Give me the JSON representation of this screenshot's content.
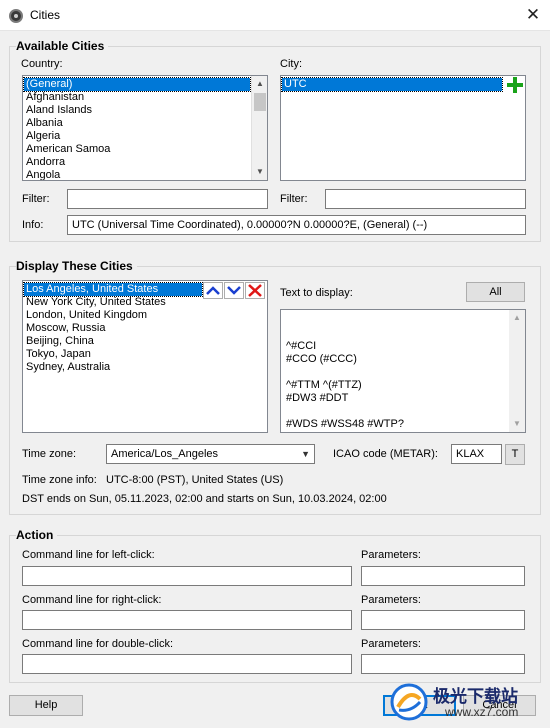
{
  "window": {
    "title": "Cities",
    "app_icon": "globe-icon"
  },
  "available": {
    "title": "Available Cities",
    "country_label": "Country:",
    "countries": [
      "(General)",
      "Afghanistan",
      "Aland Islands",
      "Albania",
      "Algeria",
      "American Samoa",
      "Andorra",
      "Angola"
    ],
    "city_label": "City:",
    "cities": [
      "UTC"
    ],
    "filter_label_left": "Filter:",
    "filter_value_left": "",
    "filter_label_right": "Filter:",
    "filter_value_right": "",
    "info_label": "Info:",
    "info_value": "UTC (Universal Time Coordinated), 0.00000?N  0.00000?E, (General) (--)"
  },
  "display": {
    "title": "Display These Cities",
    "cities": [
      "Los Angeles, United States",
      "New York City, United States",
      "London, United Kingdom",
      "Moscow, Russia",
      "Beijing, China",
      "Tokyo, Japan",
      "Sydney, Australia"
    ],
    "text_to_display_label": "Text to display:",
    "all_button": "All",
    "text_value": "^#CCI\n#CCO (#CCC)\n\n^#TTM ^(#TTZ)\n#DW3 #DDT\n\n#WDS #WSS48 #WTP?",
    "timezone_label": "Time zone:",
    "timezone_value": "America/Los_Angeles",
    "icao_label": "ICAO code (METAR):",
    "icao_value": "KLAX",
    "t_button": "T",
    "tz_info_label": "Time zone info:",
    "tz_info_value": "UTC-8:00 (PST), United States (US)",
    "dst_text": "DST ends on Sun, 05.11.2023, 02:00 and starts on Sun, 10.03.2024, 02:00"
  },
  "action": {
    "title": "Action",
    "left_click_label": "Command line for left-click:",
    "left_click_value": "",
    "right_click_label": "Command line for right-click:",
    "right_click_value": "",
    "double_click_label": "Command line for double-click:",
    "double_click_value": "",
    "params_label": "Parameters:",
    "params_left": "",
    "params_right": "",
    "params_double": ""
  },
  "footer": {
    "help_button": "Help",
    "ok_button": "OK",
    "cancel_button": "Cancel"
  },
  "watermark": {
    "text_cn": "极光下载站",
    "text_url": "www.xz7.com"
  },
  "colors": {
    "selection": "#0078d7",
    "add_green": "#1aa31a",
    "remove_red": "#e01818",
    "arrow_blue": "#1a3fd0"
  }
}
